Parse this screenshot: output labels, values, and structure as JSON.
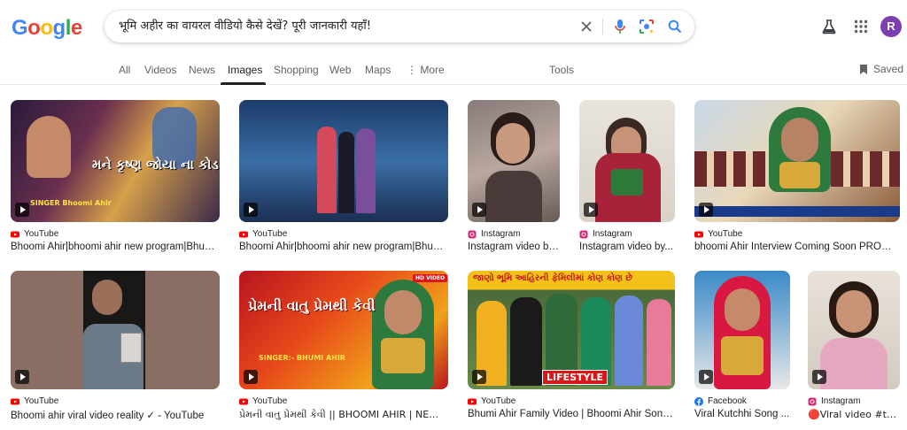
{
  "logo": {
    "letters": [
      "G",
      "o",
      "o",
      "g",
      "l",
      "e"
    ],
    "colors": [
      "#4285f4",
      "#ea4335",
      "#fbbc05",
      "#4285f4",
      "#34a853",
      "#ea4335"
    ]
  },
  "search": {
    "query": "भूमि अहीर का वायरल वीडियो कैसे देखें? पूरी जानकारी यहाँ!"
  },
  "header": {
    "avatar_letter": "R"
  },
  "tabs": [
    {
      "label": "All"
    },
    {
      "label": "Videos"
    },
    {
      "label": "News"
    },
    {
      "label": "Images"
    },
    {
      "label": "Shopping"
    },
    {
      "label": "Web"
    },
    {
      "label": "Maps"
    },
    {
      "label": "More"
    },
    {
      "label": "Tools"
    }
  ],
  "saved_label": "Saved",
  "results": [
    {
      "source": "YouTube",
      "title": "Bhoomi Ahir|bhoomi ahir new program|Bhumi...",
      "overlay": "મને કૃષ્ણ જોયા ના કોડ",
      "caption": "SINGER Bhoomi Ahir"
    },
    {
      "source": "YouTube",
      "title": "Bhoomi Ahir|bhoomi ahir new program|Bhumi..."
    },
    {
      "source": "Instagram",
      "title": "Instagram video by..."
    },
    {
      "source": "Instagram",
      "title": "Instagram video by..."
    },
    {
      "source": "YouTube",
      "title": "bhoomi Ahir Interview Coming Soon PROMO..."
    },
    {
      "source": "YouTube",
      "title": "Bhoomi ahir viral video reality ✓ - YouTube"
    },
    {
      "source": "YouTube",
      "title": "પ્રેમની વાતુ પ્રેમથી કેવી || BHOOMI AHIR | NEW ...",
      "overlay": "પ્રેમની વાતુ પ્રેમથી કેવી",
      "caption": "SINGER:- BHUMI AHIR",
      "badge": "HD VIDEO"
    },
    {
      "source": "YouTube",
      "title": "Bhumi Ahir Family Video | Bhoomi Ahir Song ...",
      "overlay": "જાણો ભૂમિ આહિરની ફેમિલીમાં કોણ કોણ છે",
      "caption": "LIFESTYLE"
    },
    {
      "source": "Facebook",
      "title": "Viral Kutchhi Song ..."
    },
    {
      "source": "Instagram",
      "title": "🔴Viral video #the..."
    }
  ]
}
